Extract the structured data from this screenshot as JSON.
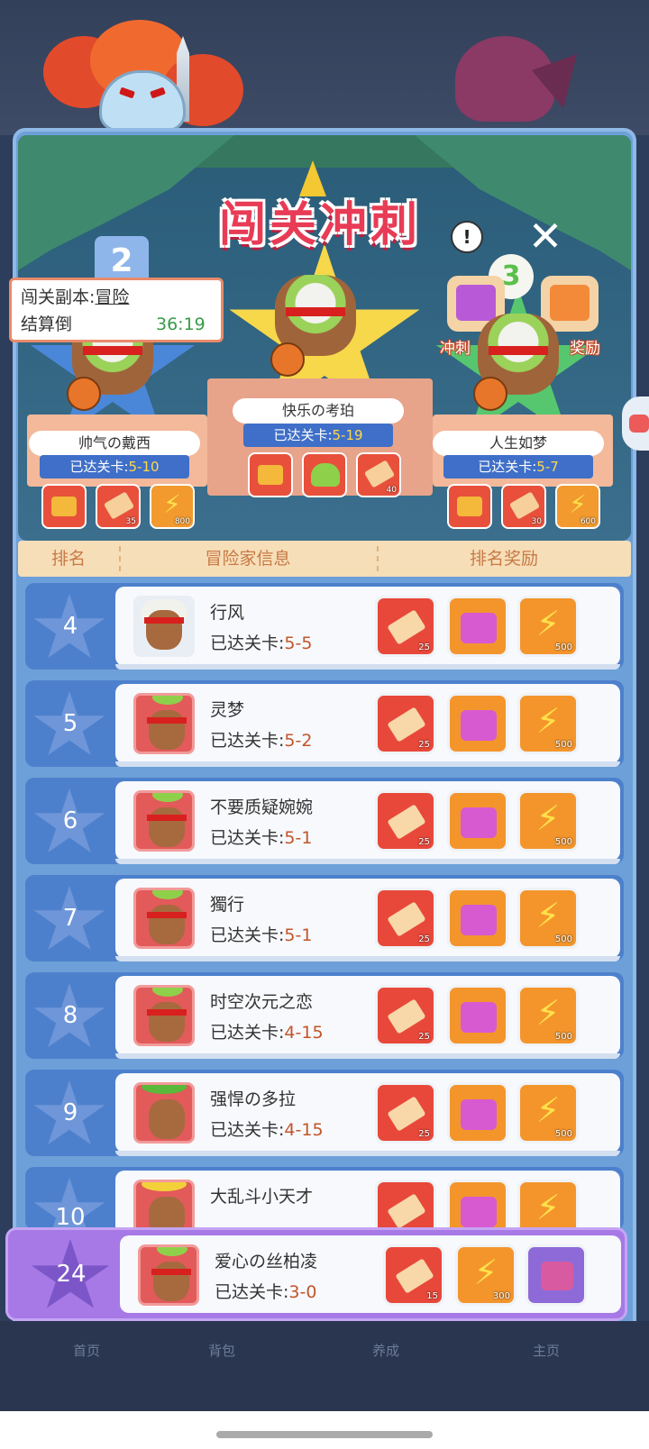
{
  "event": {
    "title": "闯关冲刺",
    "info_icon": "!",
    "close_icon": "✕",
    "dungeon_label": "闯关副本:",
    "dungeon_value": "冒险",
    "countdown_label": "结算倒",
    "countdown_value": "36:19",
    "sprint_reward_label": "冲刺",
    "final_reward_label": "奖励"
  },
  "podium": {
    "first": {
      "name": "快乐の考珀",
      "level_label": "已达关卡:",
      "level": "5-19",
      "rewards": [
        {
          "icon": "chest-icon",
          "qty": ""
        },
        {
          "icon": "slime-icon",
          "qty": ""
        },
        {
          "icon": "ticket-icon",
          "qty": "40"
        }
      ]
    },
    "second": {
      "rank": "2",
      "name": "帅气の戴西",
      "level_label": "已达关卡:",
      "level": "5-10",
      "rewards": [
        {
          "icon": "chest-icon",
          "qty": ""
        },
        {
          "icon": "ticket-icon",
          "qty": "35"
        },
        {
          "icon": "bolt-icon",
          "qty": "800"
        }
      ]
    },
    "third": {
      "rank": "3",
      "name": "人生如梦",
      "level_label": "已达关卡:",
      "level": "5-7",
      "rewards": [
        {
          "icon": "chest-icon",
          "qty": ""
        },
        {
          "icon": "ticket-icon",
          "qty": "30"
        },
        {
          "icon": "bolt-icon",
          "qty": "600"
        }
      ]
    }
  },
  "table_header": {
    "rank": "排名",
    "player_info": "冒险家信息",
    "reward": "排名奖励"
  },
  "rows": [
    {
      "rank": "4",
      "name": "行风",
      "level_label": "已达关卡:",
      "level": "5-5",
      "rewards": [
        {
          "qty": "25"
        },
        {
          "qty": ""
        },
        {
          "qty": "500"
        }
      ]
    },
    {
      "rank": "5",
      "name": "灵梦",
      "level_label": "已达关卡:",
      "level": "5-2",
      "rewards": [
        {
          "qty": "25"
        },
        {
          "qty": ""
        },
        {
          "qty": "500"
        }
      ]
    },
    {
      "rank": "6",
      "name": "不要质疑婉婉",
      "level_label": "已达关卡:",
      "level": "5-1",
      "rewards": [
        {
          "qty": "25"
        },
        {
          "qty": ""
        },
        {
          "qty": "500"
        }
      ]
    },
    {
      "rank": "7",
      "name": "獨行",
      "level_label": "已达关卡:",
      "level": "5-1",
      "rewards": [
        {
          "qty": "25"
        },
        {
          "qty": ""
        },
        {
          "qty": "500"
        }
      ]
    },
    {
      "rank": "8",
      "name": "时空次元之恋",
      "level_label": "已达关卡:",
      "level": "4-15",
      "rewards": [
        {
          "qty": "25"
        },
        {
          "qty": ""
        },
        {
          "qty": "500"
        }
      ]
    },
    {
      "rank": "9",
      "name": "强悍の多拉",
      "level_label": "已达关卡:",
      "level": "4-15",
      "rewards": [
        {
          "qty": "25"
        },
        {
          "qty": ""
        },
        {
          "qty": "500"
        }
      ]
    },
    {
      "rank": "10",
      "name": "大乱斗小天才",
      "level_label": "",
      "level": "",
      "rewards": [
        {
          "qty": ""
        },
        {
          "qty": ""
        },
        {
          "qty": ""
        }
      ]
    }
  ],
  "my_row": {
    "rank": "24",
    "name": "爱心の丝柏凌",
    "level_label": "已达关卡:",
    "level": "3-0",
    "rewards": [
      {
        "qty": "15"
      },
      {
        "qty": "300"
      },
      {
        "qty": ""
      }
    ]
  },
  "bottom_nav": [
    "首页",
    "背包",
    "养成",
    "主页"
  ]
}
